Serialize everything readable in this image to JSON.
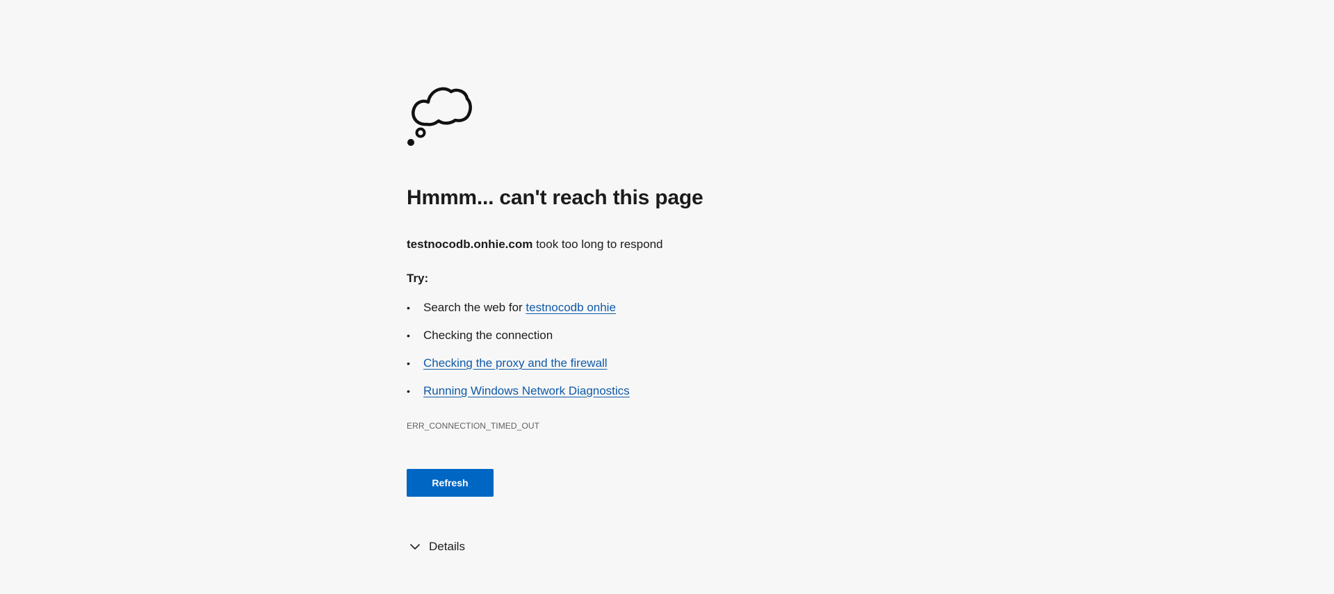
{
  "page": {
    "title": "Hmmm... can't reach this page",
    "host": "testnocodb.onhie.com",
    "message_suffix": " took too long to respond",
    "try_label": "Try:",
    "suggestions": [
      {
        "prefix": "Search the web for ",
        "link": "testnocodb onhie"
      },
      {
        "text": "Checking the connection"
      },
      {
        "link": "Checking the proxy and the firewall"
      },
      {
        "link": "Running Windows Network Diagnostics"
      }
    ],
    "bullet": "•",
    "error_code": "ERR_CONNECTION_TIMED_OUT",
    "refresh_label": "Refresh",
    "details_label": "Details"
  },
  "icons": {
    "illustration": "thought-cloud-icon",
    "details": "chevron-down-icon"
  },
  "colors": {
    "background": "#f7f7f7",
    "link": "#0f5aa8",
    "button": "#0066c4",
    "error_code": "#5f5f5f"
  }
}
